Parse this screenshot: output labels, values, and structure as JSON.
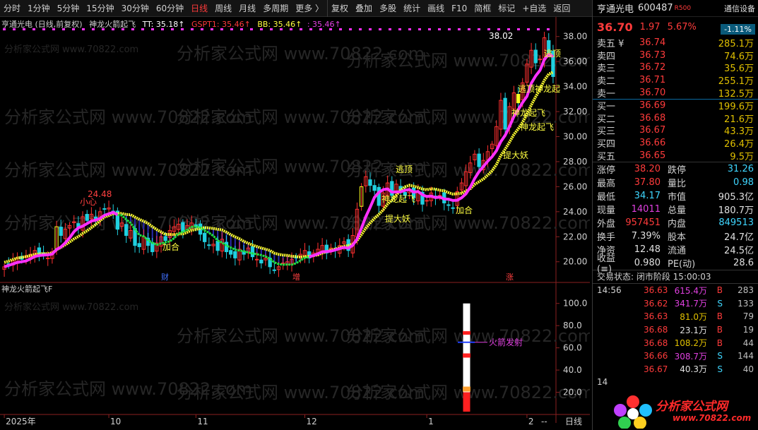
{
  "toolbar": {
    "items": [
      "分时",
      "1分钟",
      "5分钟",
      "15分钟",
      "30分钟",
      "60分钟",
      "日线",
      "周线",
      "月线",
      "多周期",
      "更多 〉",
      "复权",
      "叠加",
      "多股",
      "统计",
      "画线",
      "F10",
      "简框",
      "标记",
      "+自选",
      "返回"
    ],
    "active_index": 6
  },
  "legend": {
    "stock_period": "亨通光电 (日线,前复权)",
    "indicator": "神龙火箭起飞",
    "tt": "TT: 35.18↑",
    "gspt": "GSPT1: 35.46↑",
    "bb": "BB: 35.46↑",
    "last": ": 35.46↑"
  },
  "sub_legend": "神龙火箭起飞F",
  "watermark": "分析家公式网 www.70822.com",
  "quote": {
    "name": "亨通光电",
    "code": "600487",
    "badge": "R500",
    "btn": "通信设备",
    "price": "36.70",
    "change": "1.97",
    "pct": "5.67%",
    "index_pct": "-1.11%"
  },
  "asks": [
    {
      "name": "卖五 ¥",
      "price": "36.74",
      "qty": "285.1万"
    },
    {
      "name": "卖四",
      "price": "36.73",
      "qty": "74.6万"
    },
    {
      "name": "卖三",
      "price": "36.72",
      "qty": "35.6万"
    },
    {
      "name": "卖二",
      "price": "36.71",
      "qty": "255.1万"
    },
    {
      "name": "卖一",
      "price": "36.70",
      "qty": "132.5万"
    }
  ],
  "bids": [
    {
      "name": "买一",
      "price": "36.69",
      "qty": "199.6万"
    },
    {
      "name": "买二",
      "price": "36.68",
      "qty": "21.6万"
    },
    {
      "name": "买三",
      "price": "36.67",
      "qty": "43.3万"
    },
    {
      "name": "买四",
      "price": "36.66",
      "qty": "26.4万"
    },
    {
      "name": "买五",
      "price": "36.65",
      "qty": "9.5万"
    }
  ],
  "stats": [
    {
      "k1": "涨停",
      "v1": "38.20",
      "c1": "red",
      "k2": "跌停",
      "v2": "31.26",
      "c2": "cyan"
    },
    {
      "k1": "最高",
      "v1": "37.80",
      "c1": "red",
      "k2": "量比",
      "v2": "0.98",
      "c2": "cyan"
    },
    {
      "k1": "最低",
      "v1": "34.17",
      "c1": "cyan",
      "k2": "市值",
      "v2": "905.3亿",
      "c2": "white"
    },
    {
      "k1": "现量",
      "v1": "14011",
      "c1": "mag",
      "k2": "总量",
      "v2": "180.7万",
      "c2": "white"
    },
    {
      "k1": "外盘",
      "v1": "957451",
      "c1": "red",
      "k2": "内盘",
      "v2": "849513",
      "c2": "cyan"
    },
    {
      "k1": "换手",
      "v1": "7.39%",
      "c1": "white",
      "k2": "股本",
      "v2": "24.7亿",
      "c2": "white"
    },
    {
      "k1": "净资",
      "v1": "12.48",
      "c1": "white",
      "k2": "流通",
      "v2": "24.5亿",
      "c2": "white"
    },
    {
      "k1": "收益(≡)",
      "v1": "0.980",
      "c1": "white",
      "k2": "PE(动)",
      "v2": "28.6",
      "c2": "white"
    }
  ],
  "status": "交易状态: 闭市阶段 15:00:03",
  "ticks": [
    {
      "t": "14:56",
      "p": "36.63",
      "v": "615.4万",
      "d": "B",
      "c": "283",
      "vc": "mag"
    },
    {
      "t": "",
      "p": "36.62",
      "v": "341.7万",
      "d": "S",
      "c": "133",
      "vc": "mag"
    },
    {
      "t": "",
      "p": "36.63",
      "v": "81.0万",
      "d": "B",
      "c": "79",
      "vc": "yel"
    },
    {
      "t": "",
      "p": "36.68",
      "v": "23.1万",
      "d": "B",
      "c": "19",
      "vc": "white"
    },
    {
      "t": "",
      "p": "36.68",
      "v": "108.2万",
      "d": "B",
      "c": "44",
      "vc": "yel"
    },
    {
      "t": "",
      "p": "36.66",
      "v": "308.7万",
      "d": "S",
      "c": "144",
      "vc": "mag"
    },
    {
      "t": "",
      "p": "36.67",
      "v": "40.3万",
      "d": "S",
      "c": "40",
      "vc": "white"
    },
    {
      "t": "14",
      "p": "",
      "v": "",
      "d": "",
      "c": "",
      "vc": "white"
    }
  ],
  "logo": {
    "title": "分析家公式网",
    "url": "www.70822.com"
  },
  "chart_data": {
    "type": "candlestick",
    "y_ticks": [
      20,
      22,
      24,
      26,
      28,
      30,
      32,
      34,
      36,
      38
    ],
    "ylim": [
      18.8,
      39.0
    ],
    "sub_y_ticks": [
      20,
      40,
      60,
      80,
      100
    ],
    "sub_ylim": [
      0,
      110
    ],
    "x_labels": [
      {
        "label": "2025年",
        "index": 0
      },
      {
        "label": "10",
        "index": 24
      },
      {
        "label": "11",
        "index": 44
      },
      {
        "label": "12",
        "index": 69
      },
      {
        "label": "1",
        "index": 97
      },
      {
        "label": "2",
        "index": 120
      }
    ],
    "x_period_label": "日线",
    "scroll_label": "--",
    "n": 127,
    "closes": [
      19.6,
      19.8,
      20.1,
      20.3,
      20.2,
      20.4,
      20.6,
      20.9,
      20.6,
      20.5,
      20.3,
      20.8,
      22.8,
      22.1,
      22.6,
      22.9,
      23.2,
      22.7,
      23.6,
      23.3,
      23.8,
      23.4,
      24.0,
      24.2,
      24.3,
      24.0,
      22.6,
      23.1,
      22.1,
      22.5,
      21.3,
      21.2,
      22.0,
      21.3,
      20.8,
      21.5,
      22.0,
      21.7,
      22.5,
      22.8,
      23.0,
      22.4,
      22.9,
      23.1,
      22.8,
      22.2,
      21.6,
      21.3,
      21.4,
      20.9,
      21.8,
      20.8,
      20.6,
      20.3,
      21.0,
      20.6,
      21.1,
      20.4,
      20.2,
      19.9,
      20.3,
      19.6,
      19.3,
      19.6,
      19.9,
      20.0,
      20.2,
      20.3,
      20.6,
      20.9,
      20.3,
      20.7,
      21.0,
      21.3,
      20.7,
      21.1,
      20.9,
      21.3,
      21.6,
      20.9,
      22.1,
      24.2,
      26.0,
      26.8,
      26.1,
      25.7,
      24.5,
      25.5,
      26.3,
      25.3,
      26.2,
      25.7,
      25.3,
      25.8,
      25.1,
      25.6,
      24.6,
      24.9,
      25.5,
      25.1,
      25.3,
      24.7,
      24.5,
      24.3,
      25.6,
      26.3,
      27.2,
      27.9,
      28.6,
      27.6,
      28.1,
      28.8,
      29.4,
      30.8,
      32.9,
      30.6,
      32.4,
      33.5,
      32.7,
      34.3,
      35.8,
      36.9,
      35.9,
      36.2,
      37.9,
      36.7,
      34.8
    ],
    "sub_series": {
      "name": "火箭发射",
      "upper": 100,
      "levels": [
        20,
        55,
        65,
        75,
        85
      ],
      "signal_at": 0.83
    },
    "annotations": [
      {
        "text": "24.48",
        "color": "#ff4040"
      },
      {
        "text": "38.02",
        "color": "#ffffff"
      },
      {
        "text": "小心",
        "color": "#ff4040"
      },
      {
        "text": "逃顶",
        "color": "#ffff40"
      },
      {
        "text": "加合",
        "color": "#ffff40"
      },
      {
        "text": "逃顶神龙起",
        "color": "#ffff40"
      },
      {
        "text": "神龙起飞",
        "color": "#ffff40"
      },
      {
        "text": "提大妖",
        "color": "#ffff40"
      },
      {
        "text": "财",
        "color": "#4070ff"
      },
      {
        "text": "增",
        "color": "#ff4040"
      },
      {
        "text": "涨",
        "color": "#ff4040"
      },
      {
        "text": "火箭发射",
        "color": "#e040e0"
      }
    ]
  }
}
